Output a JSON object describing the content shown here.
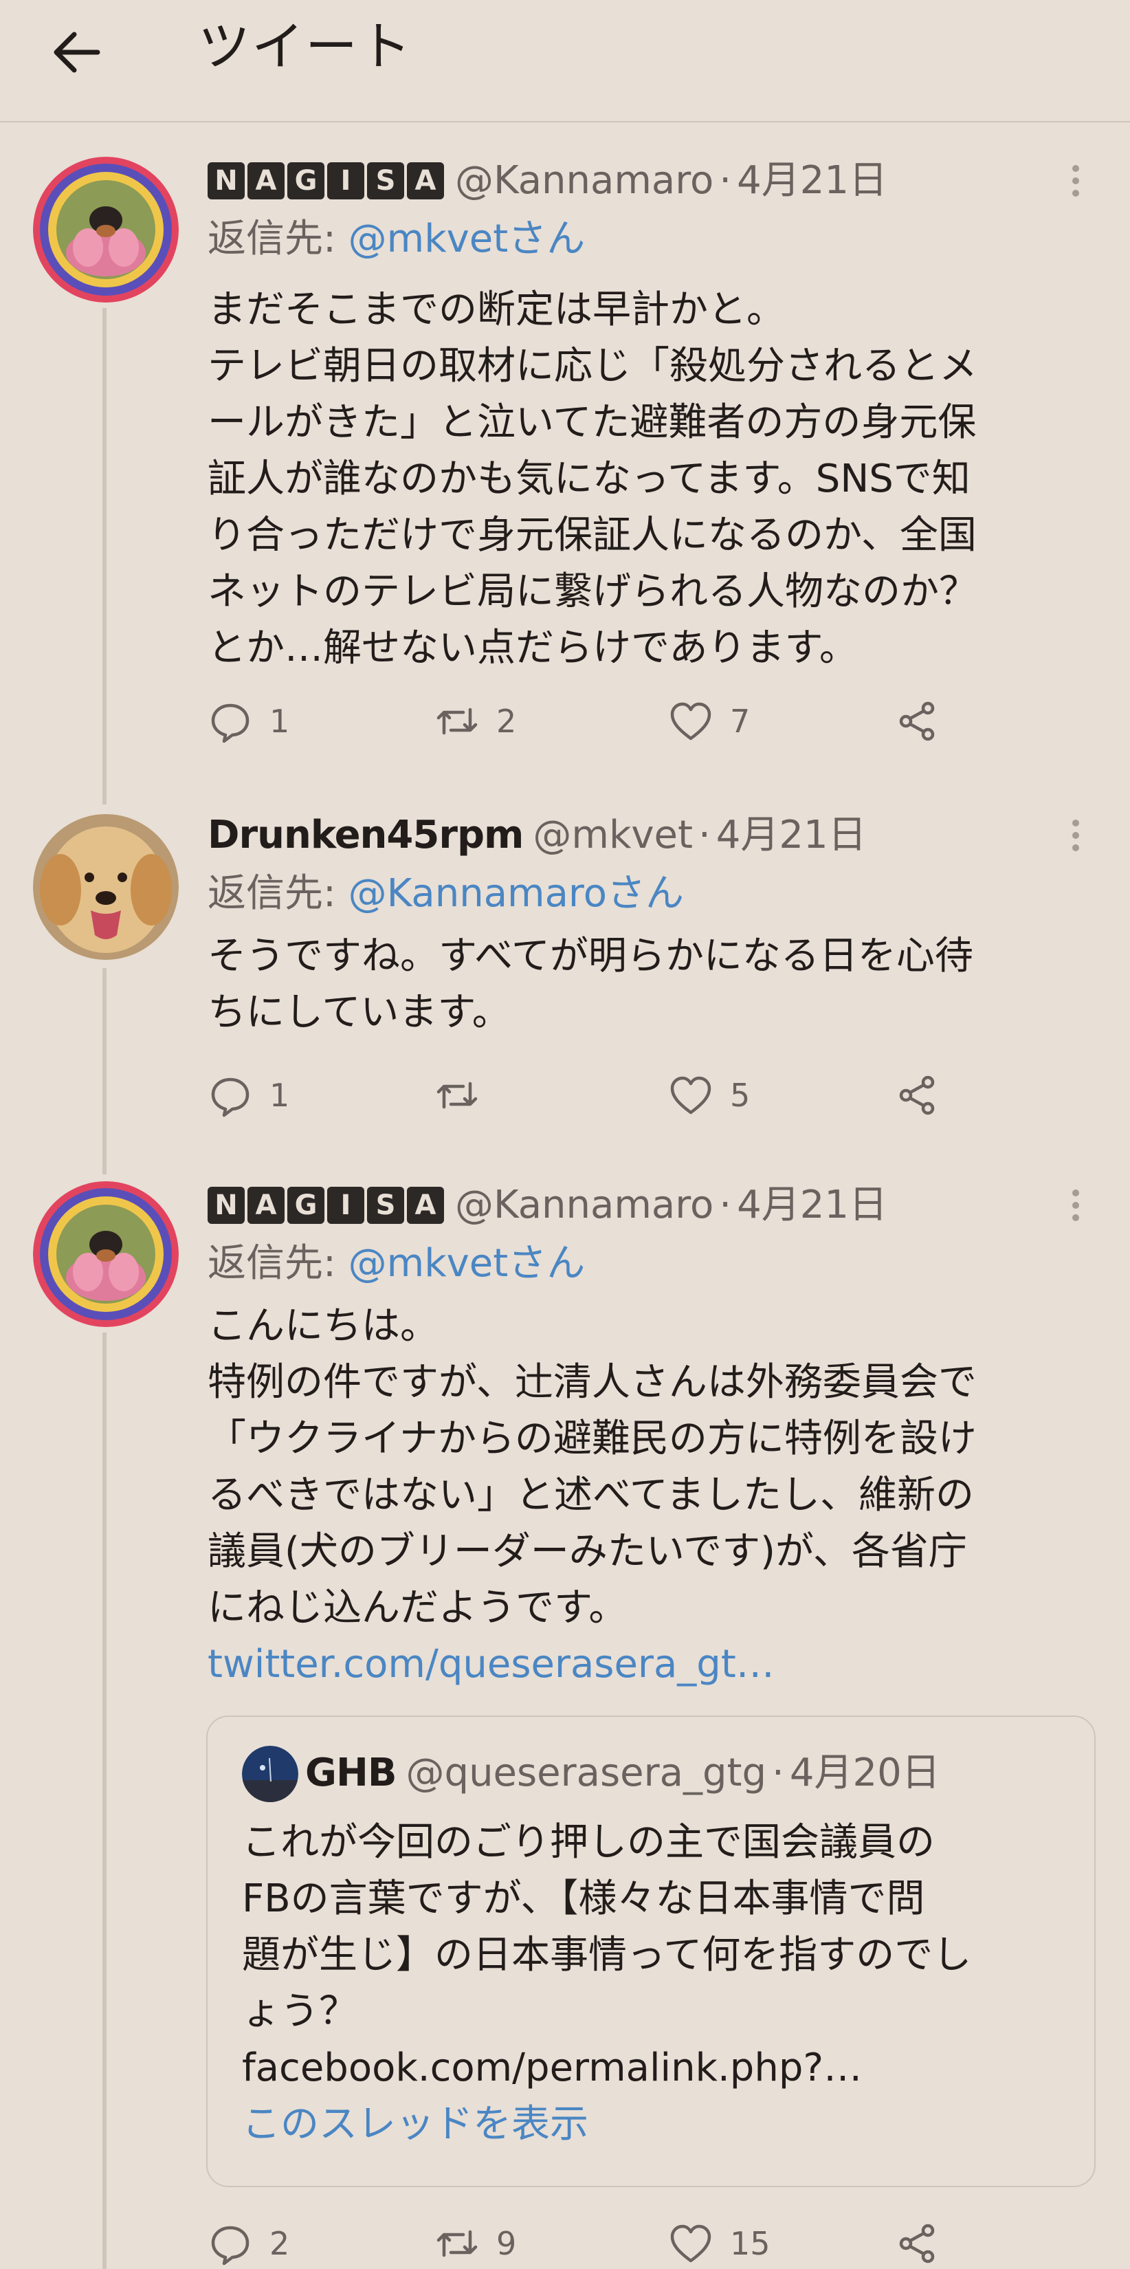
{
  "header": {
    "title": "ツイート",
    "back_icon": "back-arrow-icon"
  },
  "colors": {
    "background": "#e8dfd6",
    "link": "#4a86c3",
    "muted": "#6a625e",
    "divider": "#cfc5bb"
  },
  "tweets": [
    {
      "badges": [
        "N",
        "A",
        "G",
        "I",
        "S",
        "A"
      ],
      "display_name": "",
      "handle": "@Kannamaro",
      "separator": "·",
      "date": "4月21日",
      "reply_prefix": "返信先: ",
      "reply_to": "@mkvetさん",
      "lines": [
        "まだそこまでの断定は早計かと。",
        "テレビ朝日の取材に応じ「殺処分されるとメ",
        "ールがきた」と泣いてた避難者の方の身元保",
        "証人が誰なのかも気になってます。SNSで知",
        "り合っただけで身元保証人になるのか、全国",
        "ネットのテレビ局に繋げられる人物なのか？",
        "とか…解せない点だらけであります。"
      ],
      "link": "",
      "reply_count": "1",
      "retweet_count": "2",
      "like_count": "7"
    },
    {
      "badges": [],
      "display_name": "Drunken45rpm",
      "handle": "@mkvet",
      "separator": "·",
      "date": "4月21日",
      "reply_prefix": "返信先: ",
      "reply_to": "@Kannamaroさん",
      "lines": [
        "そうですね。すべてが明らかになる日を心待",
        "ちにしています。"
      ],
      "link": "",
      "reply_count": "1",
      "retweet_count": "",
      "like_count": "5"
    },
    {
      "badges": [
        "N",
        "A",
        "G",
        "I",
        "S",
        "A"
      ],
      "display_name": "",
      "handle": "@Kannamaro",
      "separator": "·",
      "date": "4月21日",
      "reply_prefix": "返信先: ",
      "reply_to": "@mkvetさん",
      "lines": [
        "こんにちは。",
        "特例の件ですが、辻清人さんは外務委員会で",
        "「ウクライナからの避難民の方に特例を設け",
        "るべきではない」と述べてましたし、維新の",
        "議員(犬のブリーダーみたいです)が、各省庁",
        "にねじ込んだようです。"
      ],
      "link": "twitter.com/queserasera_gt…",
      "reply_count": "2",
      "retweet_count": "9",
      "like_count": "15"
    }
  ],
  "quote": {
    "display_name": "GHB",
    "handle": "@queserasera_gtg",
    "separator": "·",
    "date": "4月20日",
    "lines": [
      "これが今回のごり押しの主で国会議員の",
      "FBの言葉ですが、【様々な日本事情で問",
      "題が生じ】の日本事情って何を指すのでし",
      "ょう？"
    ],
    "link": "facebook.com/permalink.php?…",
    "thread_link": "このスレッドを表示"
  }
}
